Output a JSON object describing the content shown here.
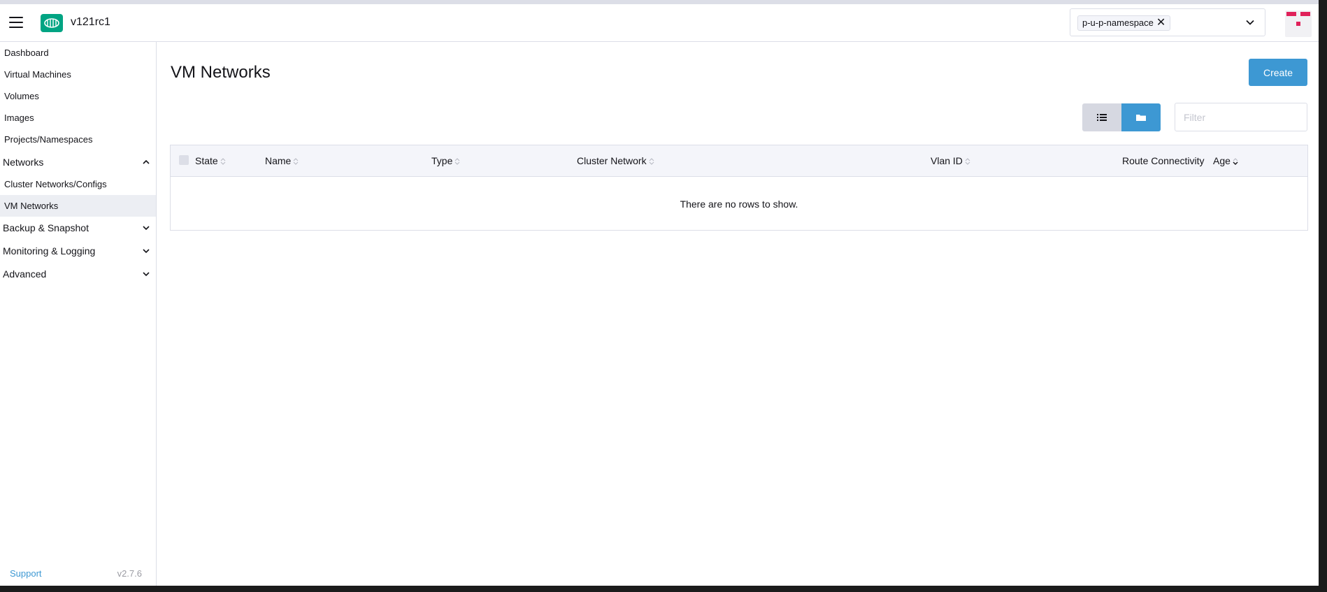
{
  "header": {
    "cluster_name": "v121rc1",
    "namespace_chip": "p-u-p-namespace"
  },
  "sidebar": {
    "items": [
      {
        "label": "Dashboard"
      },
      {
        "label": "Virtual Machines"
      },
      {
        "label": "Volumes"
      },
      {
        "label": "Images"
      },
      {
        "label": "Projects/Namespaces"
      }
    ],
    "networks_group": "Networks",
    "networks_children": [
      {
        "label": "Cluster Networks/Configs"
      },
      {
        "label": "VM Networks",
        "active": true
      }
    ],
    "groups": [
      {
        "label": "Backup & Snapshot"
      },
      {
        "label": "Monitoring & Logging"
      },
      {
        "label": "Advanced"
      }
    ],
    "support": "Support",
    "version": "v2.7.6"
  },
  "main": {
    "title": "VM Networks",
    "create_label": "Create",
    "filter_placeholder": "Filter",
    "columns": [
      "State",
      "Name",
      "Type",
      "Cluster Network",
      "Vlan ID",
      "Route Connectivity",
      "Age"
    ],
    "empty_message": "There are no rows to show."
  },
  "colors": {
    "primary": "#3d98d3",
    "logo": "#00a483",
    "avatar": "#e0215a"
  },
  "icons": {
    "menu": "hamburger-icon",
    "logo": "harvester-logo",
    "remove": "close-icon",
    "dropdown": "chevron-down-icon",
    "list_view": "list-icon",
    "group_view": "folder-icon",
    "sort": "sort-icon"
  }
}
